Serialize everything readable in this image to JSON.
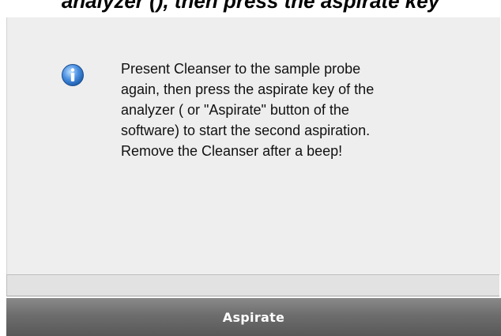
{
  "dialog": {
    "title": "analyzer (), then press the aspirate key",
    "info_icon": "info-icon",
    "message": "Present  Cleanser to the sample probe\nagain, then press the aspirate key of the\nanalyzer ( or \"Aspirate\" button of the\nsoftware) to start the second aspiration.\nRemove the Cleanser after a beep!",
    "status_text": ""
  },
  "footer": {
    "aspirate_label": "Aspirate"
  },
  "colors": {
    "panel_bg": "#eeeeee",
    "button_bg": "#6d6d6d",
    "button_text": "#ffffff",
    "icon_blue": "#3a7fd0"
  }
}
